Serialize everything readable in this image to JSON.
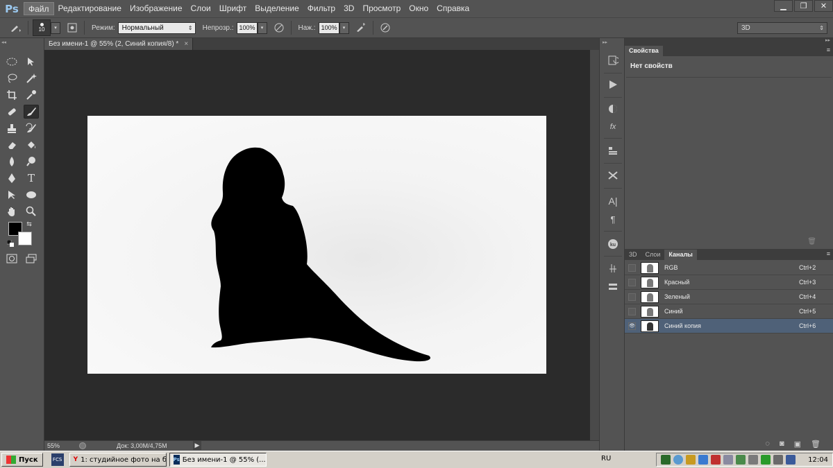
{
  "app": {
    "logo": "Ps"
  },
  "menu": [
    "Файл",
    "Редактирование",
    "Изображение",
    "Слои",
    "Шрифт",
    "Выделение",
    "Фильтр",
    "3D",
    "Просмотр",
    "Окно",
    "Справка"
  ],
  "window_controls": {
    "minimize": "▁",
    "restore": "❐",
    "close": "✕"
  },
  "options": {
    "brush_size": "10",
    "mode_label": "Режим:",
    "mode_value": "Нормальный",
    "opacity_label": "Непрозр.:",
    "opacity_value": "100%",
    "pressure_label": "Наж.:",
    "pressure_value": "100%",
    "workspace": "3D"
  },
  "document": {
    "tab_title": "Без имени-1 @ 55% (2, Синий копия/8) *",
    "close": "×",
    "zoom": "55%",
    "doc_info": "Док: 3,00M/4,75M"
  },
  "properties_panel": {
    "tab": "Свойства",
    "empty_text": "Нет свойств"
  },
  "channels_panel": {
    "tabs": [
      "3D",
      "Слои",
      "Каналы"
    ],
    "active_tab": "Каналы",
    "channels": [
      {
        "name": "RGB",
        "shortcut": "Ctrl+2",
        "visible": false,
        "selected": false
      },
      {
        "name": "Красный",
        "shortcut": "Ctrl+3",
        "visible": false,
        "selected": false
      },
      {
        "name": "Зеленый",
        "shortcut": "Ctrl+4",
        "visible": false,
        "selected": false
      },
      {
        "name": "Синий",
        "shortcut": "Ctrl+5",
        "visible": false,
        "selected": false
      },
      {
        "name": "Синий копия",
        "shortcut": "Ctrl+6",
        "visible": true,
        "selected": true
      }
    ]
  },
  "taskbar": {
    "start": "Пуск",
    "quick": "FCS",
    "tasks": [
      {
        "label": "1: студийное фото на б...",
        "icon": "Y",
        "active": false
      },
      {
        "label": "Без имени-1 @ 55% (...",
        "icon": "Ps",
        "active": true
      }
    ],
    "lang": "RU",
    "clock": "12:04"
  },
  "colors": {
    "accent_selected": "#4f6178",
    "canvas_bg": "#2b2b2b",
    "panel_bg": "#535353"
  }
}
